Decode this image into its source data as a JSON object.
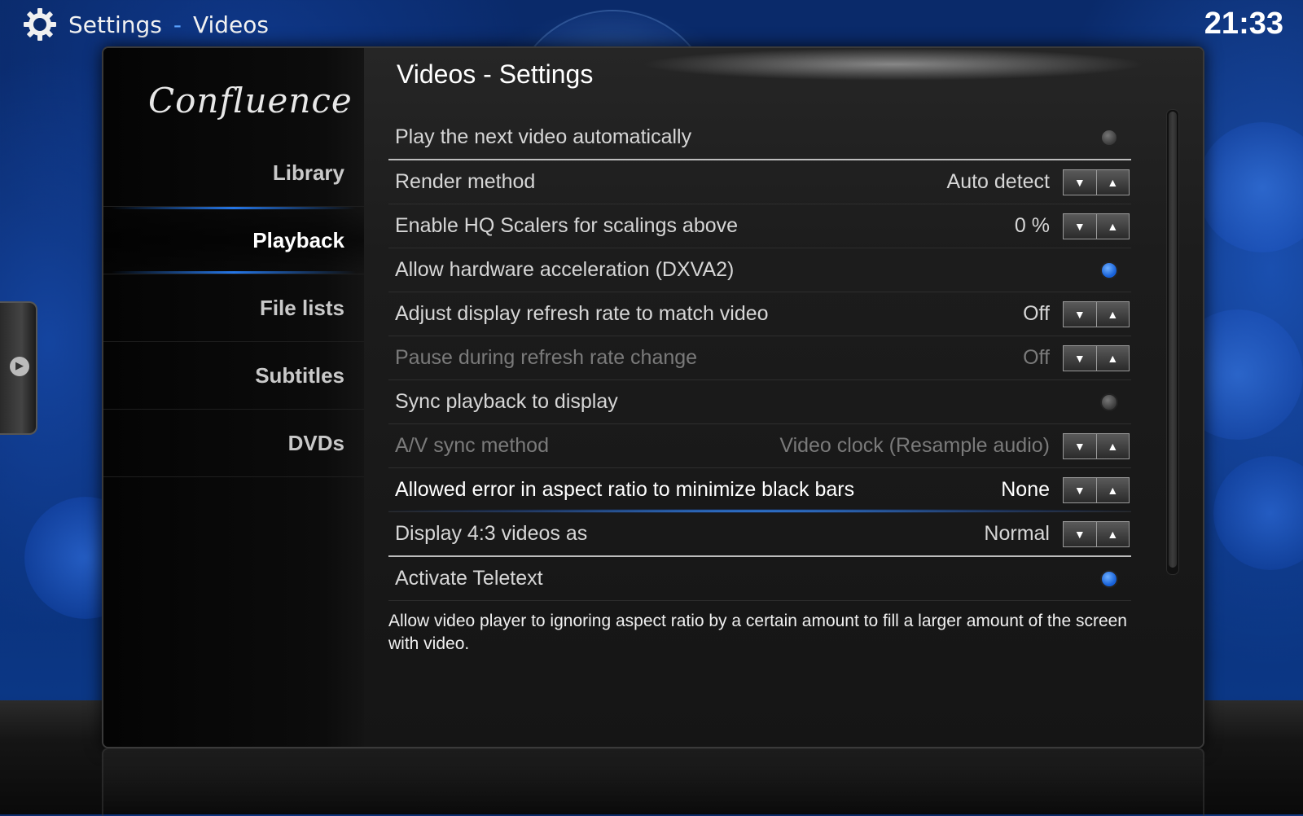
{
  "header": {
    "breadcrumb_root": "Settings",
    "breadcrumb_sep": "-",
    "breadcrumb_current": "Videos",
    "clock": "21:33"
  },
  "skin": {
    "logo": "Confluence"
  },
  "nav": {
    "items": [
      {
        "label": "Library"
      },
      {
        "label": "Playback"
      },
      {
        "label": "File lists"
      },
      {
        "label": "Subtitles"
      },
      {
        "label": "DVDs"
      }
    ],
    "active": "Playback"
  },
  "section": {
    "title": "Videos - Settings"
  },
  "settings": [
    {
      "label": "Play the next video automatically",
      "control": "radio",
      "on": false
    },
    {
      "label": "Render method",
      "control": "spinner",
      "value": "Auto detect"
    },
    {
      "label": "Enable HQ Scalers for scalings above",
      "control": "spinner",
      "value": "0 %"
    },
    {
      "label": "Allow hardware acceleration (DXVA2)",
      "control": "radio",
      "on": true
    },
    {
      "label": "Adjust display refresh rate to match video",
      "control": "spinner",
      "value": "Off"
    },
    {
      "label": "Pause during refresh rate change",
      "control": "spinner",
      "value": "Off",
      "disabled": true
    },
    {
      "label": "Sync playback to display",
      "control": "radio",
      "on": false
    },
    {
      "label": "A/V sync method",
      "control": "spinner",
      "value": "Video clock (Resample audio)",
      "disabled": true
    },
    {
      "label": "Allowed error in aspect ratio to minimize black bars",
      "control": "spinner",
      "value": "None",
      "focused": true
    },
    {
      "label": "Display 4:3 videos as",
      "control": "spinner",
      "value": "Normal"
    },
    {
      "label": "Activate Teletext",
      "control": "radio",
      "on": true
    }
  ],
  "description": "Allow video player to ignoring aspect ratio by a certain amount to fill a larger amount of the screen with video.",
  "icons": {
    "settings": "gear-icon",
    "side_tab": "chevron-right-icon",
    "spin_down": "triangle-down-icon",
    "spin_up": "triangle-up-icon"
  },
  "colors": {
    "accent": "#3a8cff",
    "radio_on": "#1660d8"
  }
}
